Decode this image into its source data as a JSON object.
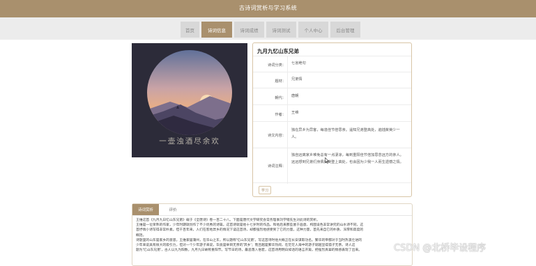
{
  "header": {
    "title": "古诗词赏析与学习系统"
  },
  "nav": {
    "items": [
      {
        "label": "首页",
        "active": false
      },
      {
        "label": "诗词信息",
        "active": true
      },
      {
        "label": "诗词成绩",
        "active": false
      },
      {
        "label": "诗词测试",
        "active": false
      },
      {
        "label": "个人中心",
        "active": false
      },
      {
        "label": "后台管理",
        "active": false
      }
    ]
  },
  "poster": {
    "caption": "一壶浊酒尽余欢"
  },
  "poem": {
    "title": "九月九忆山东兄弟",
    "fields": [
      {
        "label": "诗词分类：",
        "value": "七言绝句"
      },
      {
        "label": "题材：",
        "value": "兄弟情"
      },
      {
        "label": "朝代：",
        "value": "唐朝"
      },
      {
        "label": "作者：",
        "value": "王维"
      },
      {
        "label": "诗文内容：",
        "value": "独在异乡为异客，每逢佳节倍思亲。遥知兄弟登高处，遍插茱萸少一人。"
      },
      {
        "label": "诗词注释：",
        "value": "独自远离家乡难免总有一点凄凉，每到重阳佳节倍加思念远方的亲人。远远想到兄弟们身佩茱萸登上高处，也会因为少我一人而生遗憾之情。"
      }
    ],
    "study_button": "学习"
  },
  "detail": {
    "tabs": [
      {
        "label": "诗词赏析"
      },
      {
        "label": "评价"
      }
    ],
    "lines": [
      "王维这首《九月九日忆山东兄弟》载于《全唐诗》卷一百二十八。下面是唐代文学研究会常务理事刘学锴先生对此诗的赏析。",
      "王维是一位早熟的作家，少年时期就创作了不少优秀的诗篇。这首诗就是他十七岁时的作品。和他后来那些富于画意、构图设色非常讲究的山水诗不同，这",
      "首抒情小诗写得非常朴素。但千百年来，人们在客地异乡的情况下读这首诗，却都强烈地感受到了它的力量。这种力量，首先来自它的朴质、深厚和高度的",
      "概括。",
      "诗题里的山东是家乡的意思，王维家居蒲州，在华山之东，所以题称'忆山东兄弟'。写这首诗时他大概正在长安谋取功名。繁华的帝都对于当时热衷仕进的",
      "少年来说具有很大的吸引力，但对一个少年游子来说，毕竟是举目无亲的'异乡'；而且越是繁华热闹，在茫茫人海中的游子就越显得孤孑无亲。诗人这",
      "题为'忆山东兄弟'，古人以九为阳数，九月九日故称重阳节。写节日的诗，最忌落入俗套，这首诗用明白如话的语言开篇，把强烈真挚的情感表现了出来。"
    ]
  },
  "watermark": "CSDN @北桥毕设程序"
}
